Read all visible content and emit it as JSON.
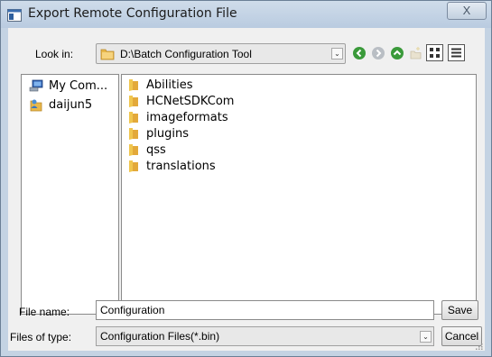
{
  "window": {
    "title": "Export Remote Configuration File",
    "close_glyph": "X"
  },
  "toolbar": {
    "look_in_label": "Look in:",
    "look_in_path": "D:\\Batch Configuration Tool",
    "icons": [
      "back-icon",
      "forward-icon",
      "up-folder-icon",
      "new-folder-icon",
      "list-view-icon",
      "detail-view-icon"
    ]
  },
  "sidebar": {
    "items": [
      {
        "label": "My Com...",
        "icon": "computer-icon"
      },
      {
        "label": "daijun5",
        "icon": "user-folder-icon"
      }
    ]
  },
  "files": [
    {
      "name": "Abilities",
      "icon": "folder-icon"
    },
    {
      "name": "HCNetSDKCom",
      "icon": "folder-icon"
    },
    {
      "name": "imageformats",
      "icon": "folder-icon"
    },
    {
      "name": "plugins",
      "icon": "folder-icon"
    },
    {
      "name": "qss",
      "icon": "folder-icon"
    },
    {
      "name": "translations",
      "icon": "folder-icon"
    }
  ],
  "footer": {
    "file_name_label": "File name:",
    "file_name_value": "Configuration",
    "file_type_label": "Files of type:",
    "file_type_value": "Configuration Files(*.bin)",
    "save_label": "Save",
    "cancel_label": "Cancel"
  },
  "colors": {
    "title_bar": "#c4d3e3",
    "client": "#f0f0f0",
    "folder": "#e8b84a",
    "nav_green": "#3a9a3a"
  }
}
